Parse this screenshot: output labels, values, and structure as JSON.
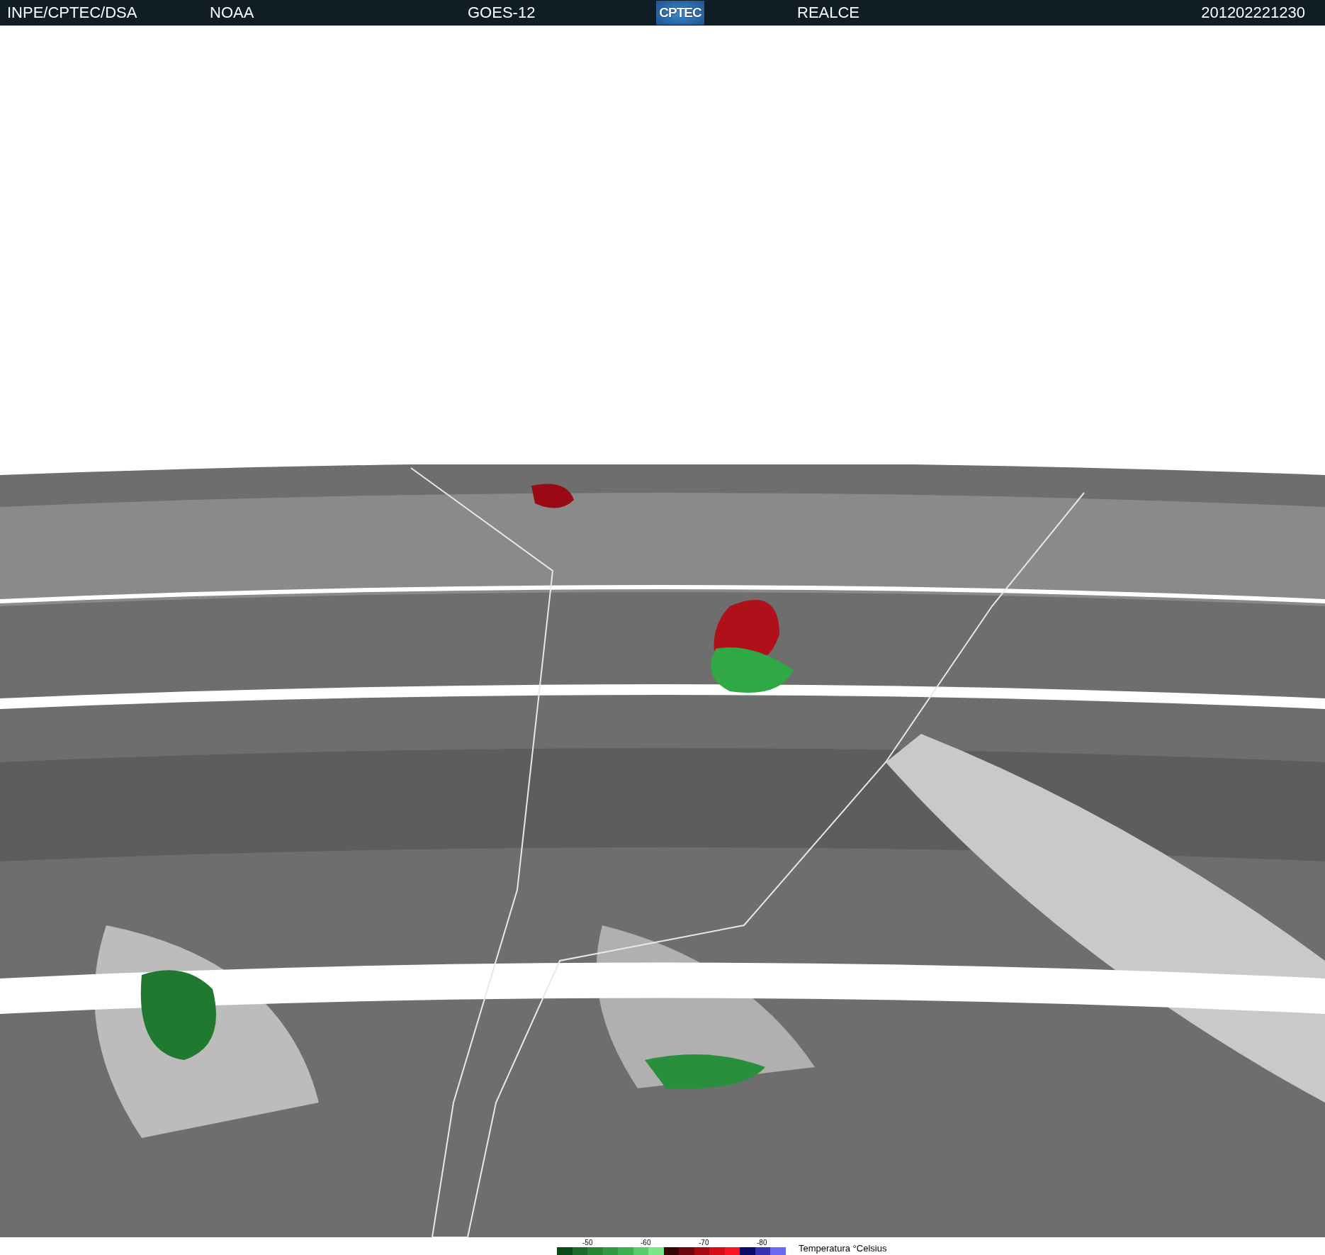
{
  "header": {
    "items": [
      {
        "kind": "text",
        "text": "INPE/CPTEC/DSA"
      },
      {
        "kind": "text",
        "text": "NOAA"
      },
      {
        "kind": "text",
        "text": "GOES-12"
      },
      {
        "kind": "logo",
        "text": "CPTEC"
      },
      {
        "kind": "text",
        "text": "REALCE"
      },
      {
        "kind": "text",
        "text": "201202221230"
      }
    ]
  },
  "legend": {
    "ticks": [
      "-50",
      "-60",
      "-70",
      "-80"
    ],
    "swatches": [
      {
        "color": "#0b4a16"
      },
      {
        "color": "#1c6b2a"
      },
      {
        "color": "#258436"
      },
      {
        "color": "#2f9a43"
      },
      {
        "color": "#3cb152"
      },
      {
        "color": "#57cc69"
      },
      {
        "color": "#7ae88a"
      },
      {
        "color": "#3a0308"
      },
      {
        "color": "#6e0710"
      },
      {
        "color": "#a80a14"
      },
      {
        "color": "#d40c18"
      },
      {
        "color": "#f51420"
      },
      {
        "color": "#0d0a6a"
      },
      {
        "color": "#3533b0"
      },
      {
        "color": "#6a6af0"
      }
    ],
    "title": "Temperatura °Celsius"
  }
}
